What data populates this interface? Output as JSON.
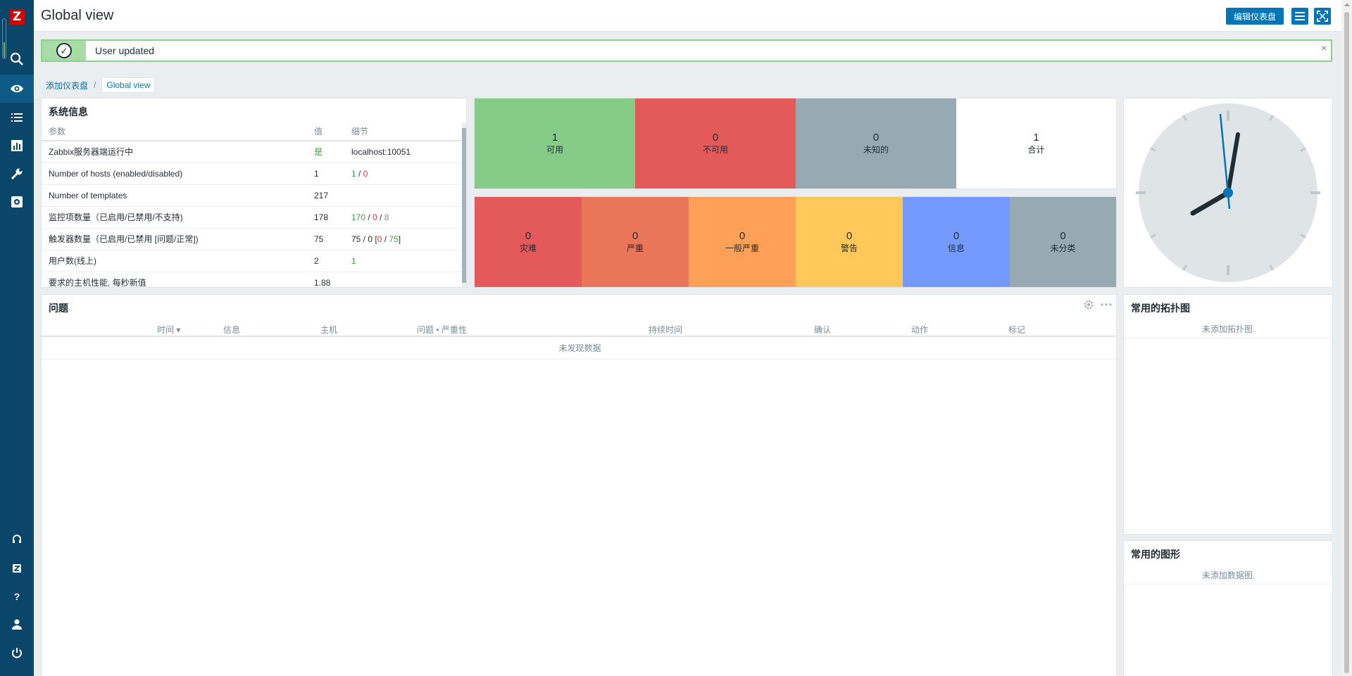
{
  "app": {
    "logo_letter": "Z"
  },
  "header": {
    "title": "Global view",
    "edit_button": "编辑仪表盘",
    "menu_icon": "menu-icon",
    "fullscreen_icon": "fullscreen-icon"
  },
  "sidebar": {
    "items": [
      {
        "name": "search-icon"
      },
      {
        "name": "monitoring-eye-icon",
        "active": true
      },
      {
        "name": "list-icon"
      },
      {
        "name": "reports-chart-icon"
      },
      {
        "name": "wrench-icon"
      },
      {
        "name": "admin-gear-icon"
      }
    ],
    "bottom_items": [
      {
        "name": "support-headset-icon"
      },
      {
        "name": "zabbix-share-icon",
        "label": "Z"
      },
      {
        "name": "help-icon",
        "label": "?"
      },
      {
        "name": "user-icon"
      },
      {
        "name": "logout-power-icon"
      }
    ]
  },
  "message": {
    "text": "User updated",
    "close": "×",
    "check": "✓"
  },
  "breadcrumb": {
    "parent": "添加仪表盘",
    "separator": "/",
    "current": "Global view"
  },
  "system_info": {
    "title": "系统信息",
    "headers": {
      "param": "参数",
      "value": "值",
      "details": "细节"
    },
    "rows": {
      "r0": {
        "param": "Zabbix服务器端运行中",
        "value": "是",
        "details": "localhost:10051"
      },
      "r1": {
        "param": "Number of hosts (enabled/disabled)",
        "value": "1",
        "d1": "1",
        "sep1": " / ",
        "d2": "0"
      },
      "r2": {
        "param": "Number of templates",
        "value": "217"
      },
      "r3": {
        "param": "监控项数量（已启用/已禁用/不支持)",
        "value": "178",
        "d1": "170",
        "sep1": " / ",
        "d2": "0",
        "sep2": " / ",
        "d3": "8"
      },
      "r4": {
        "param": "触发器数量（已启用/已禁用 [问题/正常])",
        "value": "75",
        "d0": "75 / 0 [",
        "d1": "0",
        "sep1": " / ",
        "d2": "75",
        "d3": "]"
      },
      "r5": {
        "param": "用户数(线上)",
        "value": "2",
        "details": "1"
      },
      "r6": {
        "param": "要求的主机性能, 每秒新值",
        "value": "1.88"
      }
    }
  },
  "host_availability": {
    "available": {
      "count": "1",
      "label": "可用",
      "color": "#86cc89"
    },
    "unavailable": {
      "count": "0",
      "label": "不可用",
      "color": "#e45959"
    },
    "unknown": {
      "count": "0",
      "label": "未知的",
      "color": "#97aab3"
    },
    "total": {
      "count": "1",
      "label": "合计",
      "color": "#ffffff"
    }
  },
  "problems_by_severity": {
    "disaster": {
      "count": "0",
      "label": "灾难",
      "color": "#e45959"
    },
    "high": {
      "count": "0",
      "label": "严重",
      "color": "#e97659"
    },
    "average": {
      "count": "0",
      "label": "一般严重",
      "color": "#ffa059"
    },
    "warning": {
      "count": "0",
      "label": "警告",
      "color": "#ffc859"
    },
    "information": {
      "count": "0",
      "label": "信息",
      "color": "#7499ff"
    },
    "not_classified": {
      "count": "0",
      "label": "未分类",
      "color": "#97aab3"
    }
  },
  "clock": {
    "time_shown": "08:02"
  },
  "problems": {
    "title": "问题",
    "columns": {
      "time": "时间 ▾",
      "info": "信息",
      "host": "主机",
      "problem": "问题 • 严重性",
      "duration": "持续时间",
      "ack": "确认",
      "actions": "动作",
      "tags": "标记"
    },
    "empty": "未发现数据"
  },
  "fav_maps": {
    "title": "常用的拓扑图",
    "empty": "未添加拓扑图."
  },
  "fav_graphs": {
    "title": "常用的图形",
    "empty": "未添加数据图."
  }
}
